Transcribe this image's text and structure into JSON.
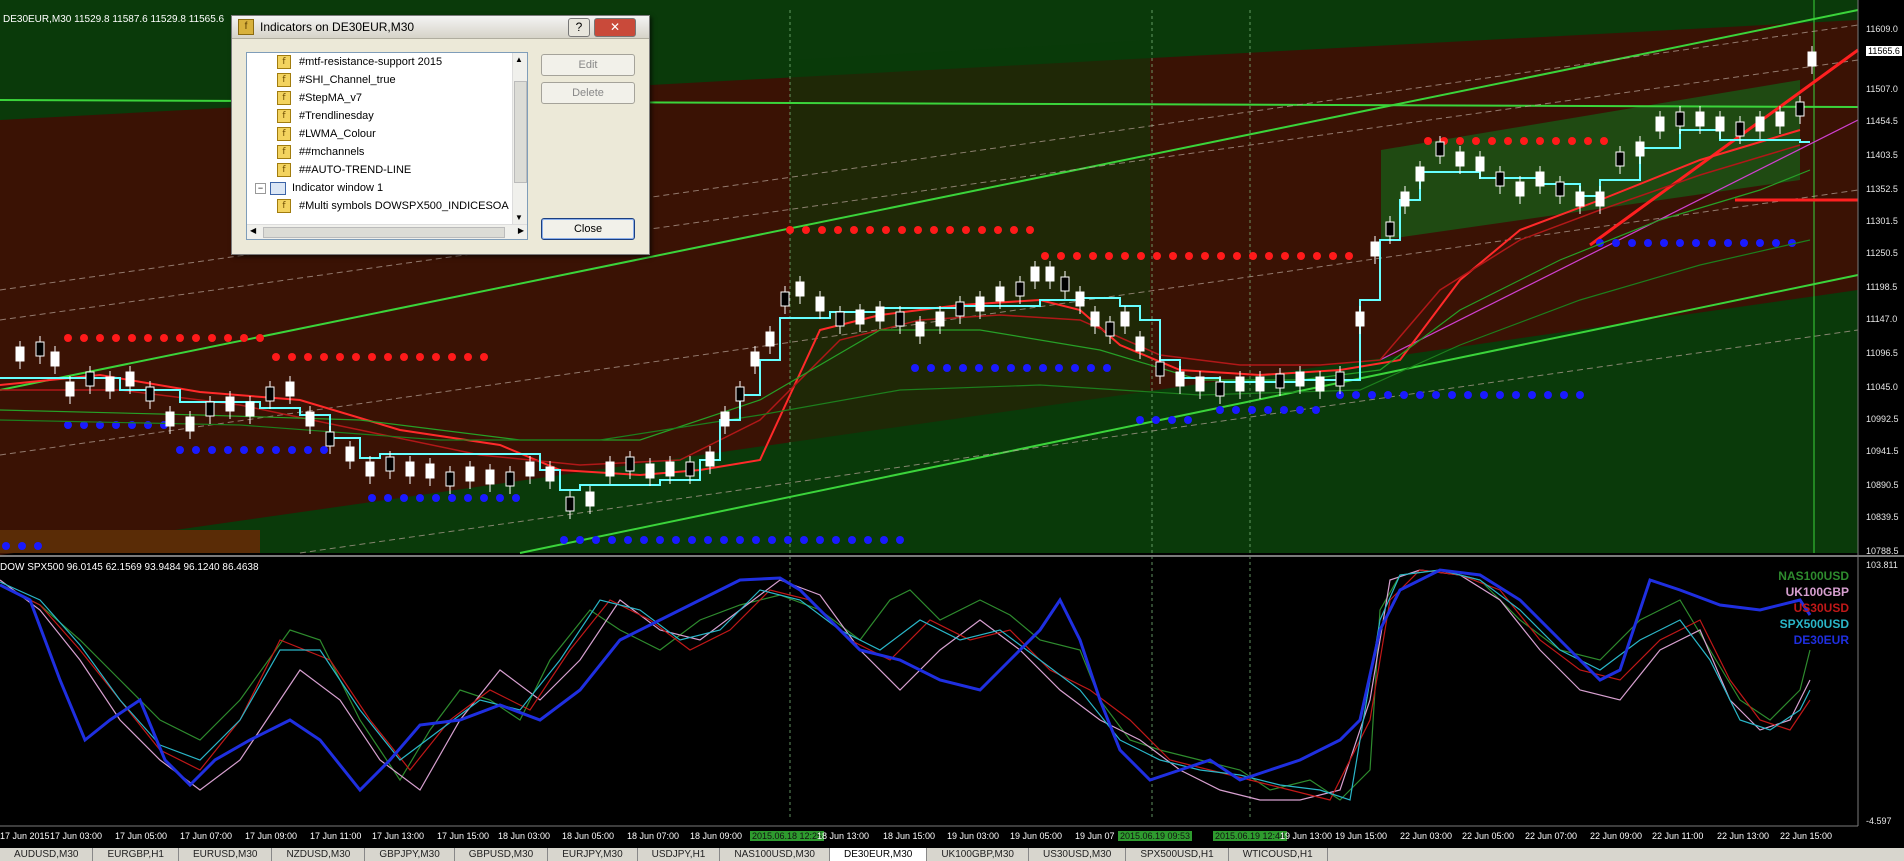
{
  "main_chart": {
    "title": "DE30EUR,M30  11529.8 11587.6 11529.8 11565.6",
    "current_price": "11565.6",
    "price_labels": [
      "11609.0",
      "11507.0",
      "11454.5",
      "11403.5",
      "11352.5",
      "11301.5",
      "11250.5",
      "11198.5",
      "11147.0",
      "11096.5",
      "11045.0",
      "10992.5",
      "10941.5",
      "10890.5",
      "10839.5",
      "10788.5"
    ]
  },
  "sub_window": {
    "title": "DOW SPX500 96.0145 62.1569 93.9484 96.1240 86.4638",
    "top_label": "103.811",
    "bottom_label": "-4.597",
    "legend": [
      {
        "name": "NAS100USD",
        "color": "#2e8b2e"
      },
      {
        "name": "UK100GBP",
        "color": "#d7a0d0"
      },
      {
        "name": "US30USD",
        "color": "#c01818"
      },
      {
        "name": "SPX500USD",
        "color": "#2ab6c8"
      },
      {
        "name": "DE30EUR",
        "color": "#1f2fe0"
      }
    ]
  },
  "time_axis": [
    "17 Jun 2015",
    "17 Jun 03:00",
    "17 Jun 05:00",
    "17 Jun 07:00",
    "17 Jun 09:00",
    "17 Jun 11:00",
    "17 Jun 13:00",
    "17 Jun 15:00",
    "18 Jun 03:00",
    "18 Jun 05:00",
    "18 Jun 07:00",
    "18 Jun 09:00",
    "2015.06.18 12:25",
    "18 Jun 13:00",
    "18 Jun 15:00",
    "19 Jun 03:00",
    "19 Jun 05:00",
    "19 Jun 07",
    "2015.06.19 09:53",
    "2015.06.19 12:44",
    "19 Jun 13:00",
    "19 Jun 15:00",
    "22 Jun 03:00",
    "22 Jun 05:00",
    "22 Jun 07:00",
    "22 Jun 09:00",
    "22 Jun 11:00",
    "22 Jun 13:00",
    "22 Jun 15:00"
  ],
  "dialog": {
    "title": "Indicators on DE30EUR,M30",
    "help_label": "?",
    "close_x": "✕",
    "items": [
      {
        "label": "#mtf-resistance-support 2015",
        "kind": "indicator"
      },
      {
        "label": "#SHI_Channel_true",
        "kind": "indicator"
      },
      {
        "label": "#StepMA_v7",
        "kind": "indicator"
      },
      {
        "label": "#Trendlinesday",
        "kind": "indicator"
      },
      {
        "label": "#LWMA_Colour",
        "kind": "indicator"
      },
      {
        "label": "##mchannels",
        "kind": "indicator"
      },
      {
        "label": "##AUTO-TREND-LINE",
        "kind": "indicator"
      },
      {
        "label": "Indicator window 1",
        "kind": "window"
      },
      {
        "label": "#Multi symbols  DOWSPX500_INDICESOA",
        "kind": "indicator"
      }
    ],
    "edit_label": "Edit",
    "delete_label": "Delete",
    "close_label": "Close"
  },
  "tabs": [
    "AUDUSD,M30",
    "EURGBP,H1",
    "EURUSD,M30",
    "NZDUSD,M30",
    "GBPJPY,M30",
    "GBPUSD,M30",
    "EURJPY,M30",
    "USDJPY,H1",
    "NAS100USD,M30",
    "DE30EUR,M30",
    "UK100GBP,M30",
    "US30USD,M30",
    "SPX500USD,H1",
    "WTICOUSD,H1"
  ],
  "active_tab": "DE30EUR,M30",
  "colors": {
    "up_channel": "#3a1204",
    "green_zone": "#0a3a0a",
    "trend_green": "#3bd43b",
    "resistance_dots": "#ff1a1a",
    "support_dots": "#1a1aff",
    "step_ma": "#66ffff"
  }
}
